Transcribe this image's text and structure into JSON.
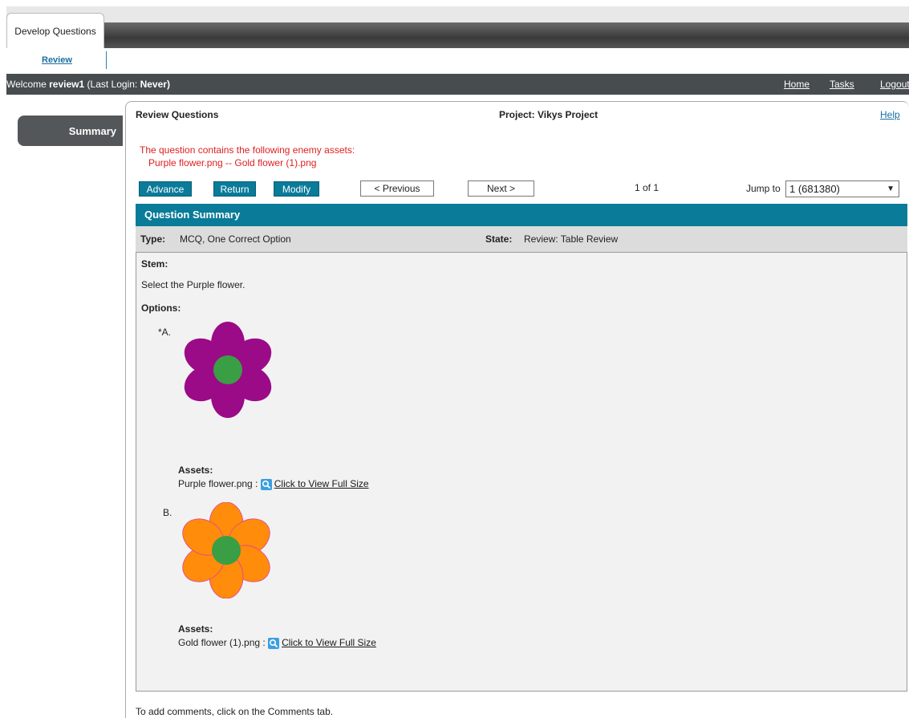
{
  "tabs": {
    "active_label": "Develop Questions"
  },
  "subnav": {
    "review_label": "Review"
  },
  "welcome": {
    "prefix": "Welcome",
    "user": "review1",
    "last_login_prefix": "(Last Login:",
    "last_login_value": "Never)",
    "links": {
      "home": "Home",
      "tasks": "Tasks",
      "logout": "Logout"
    }
  },
  "sidebar": {
    "summary_label": "Summary"
  },
  "header": {
    "title": "Review Questions",
    "project_label": "Project: Vikys Project",
    "help_label": "Help"
  },
  "warning": {
    "line1": "The question contains the following enemy assets:",
    "line2": "Purple flower.png -- Gold flower (1).png"
  },
  "actions": {
    "advance": "Advance",
    "return": "Return",
    "modify": "Modify",
    "previous": "< Previous",
    "next": "Next >",
    "counter": "1 of 1",
    "jump_label": "Jump to",
    "jump_value": "1 (681380)"
  },
  "summary": {
    "section_title": "Question Summary",
    "type_label": "Type:",
    "type_value": "MCQ, One Correct Option",
    "state_label": "State:",
    "state_value": "Review: Table Review",
    "stem_label": "Stem:",
    "stem_text": "Select the Purple flower.",
    "options_label": "Options:"
  },
  "options": [
    {
      "letter": "*A.",
      "assets_label": "Assets:",
      "asset_file": "Purple flower.png :",
      "view_link": "Click to View Full Size",
      "petal_color": "#9b0a87",
      "center_color": "#3a9e45"
    },
    {
      "letter": "B.",
      "assets_label": "Assets:",
      "asset_file": "Gold flower (1).png :",
      "view_link": "Click to View Full Size",
      "petal_color": "#ff8c0a",
      "center_color": "#3a9e45"
    }
  ],
  "footer": {
    "comments_hint": "To add comments, click on the Comments tab."
  },
  "colors": {
    "accent": "#0a7b99",
    "warning": "#e02020",
    "header_bar": "#474c4f"
  }
}
